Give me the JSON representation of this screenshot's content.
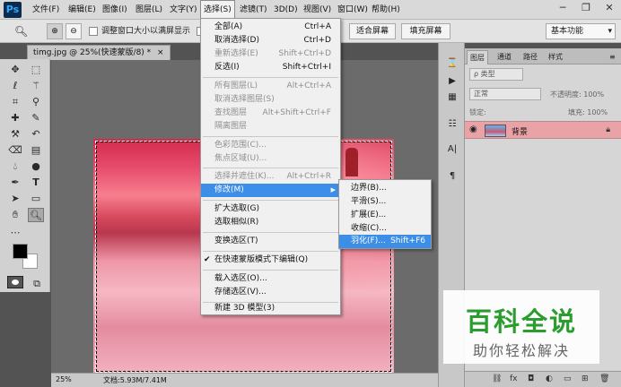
{
  "app": {
    "logo": "Ps"
  },
  "menubar": {
    "items": [
      "文件(F)",
      "编辑(E)",
      "图像(I)",
      "图层(L)",
      "文字(Y)",
      "选择(S)",
      "滤镜(T)",
      "3D(D)",
      "视图(V)",
      "窗口(W)",
      "帮助(H)"
    ],
    "active_index": 5
  },
  "options_bar": {
    "resize_windows_label": "调整窗口大小以满屏显示",
    "fit_screen_label": "适合屏幕",
    "fill_screen_label": "填充屏幕",
    "workspace": "基本功能"
  },
  "document": {
    "tab_title": "timg.jpg @ 25%(快速蒙版/8) *",
    "tab_close": "×",
    "zoom": "25%",
    "doc_size": "文档:5.93M/7.41M"
  },
  "select_menu": {
    "items": [
      {
        "label": "全部(A)",
        "shortcut": "Ctrl+A",
        "disabled": false
      },
      {
        "label": "取消选择(D)",
        "shortcut": "Ctrl+D",
        "disabled": false
      },
      {
        "label": "重新选择(E)",
        "shortcut": "Shift+Ctrl+D",
        "disabled": true
      },
      {
        "label": "反选(I)",
        "shortcut": "Shift+Ctrl+I",
        "disabled": false
      },
      {
        "label": "所有图层(L)",
        "shortcut": "Alt+Ctrl+A",
        "disabled": true
      },
      {
        "label": "取消选择图层(S)",
        "shortcut": "",
        "disabled": true
      },
      {
        "label": "查找图层",
        "shortcut": "Alt+Shift+Ctrl+F",
        "disabled": true
      },
      {
        "label": "隔离图层",
        "shortcut": "",
        "disabled": true
      },
      {
        "label": "色彩范围(C)...",
        "shortcut": "",
        "disabled": true
      },
      {
        "label": "焦点区域(U)...",
        "shortcut": "",
        "disabled": true
      },
      {
        "label": "选择并遮住(K)...",
        "shortcut": "Alt+Ctrl+R",
        "disabled": true
      },
      {
        "label": "修改(M)",
        "shortcut": "",
        "disabled": false
      },
      {
        "label": "扩大选取(G)",
        "shortcut": "",
        "disabled": false
      },
      {
        "label": "选取相似(R)",
        "shortcut": "",
        "disabled": false
      },
      {
        "label": "变换选区(T)",
        "shortcut": "",
        "disabled": false
      },
      {
        "label": "在快速蒙版模式下编辑(Q)",
        "shortcut": "",
        "disabled": false
      },
      {
        "label": "载入选区(O)...",
        "shortcut": "",
        "disabled": false
      },
      {
        "label": "存储选区(V)...",
        "shortcut": "",
        "disabled": false
      },
      {
        "label": "新建 3D 模型(3)",
        "shortcut": "",
        "disabled": false
      }
    ]
  },
  "modify_submenu": {
    "items": [
      {
        "label": "边界(B)...",
        "shortcut": ""
      },
      {
        "label": "平滑(S)...",
        "shortcut": ""
      },
      {
        "label": "扩展(E)...",
        "shortcut": ""
      },
      {
        "label": "收缩(C)...",
        "shortcut": ""
      },
      {
        "label": "羽化(F)...",
        "shortcut": "Shift+F6"
      }
    ]
  },
  "layers_panel": {
    "tabs": [
      "图层",
      "通道",
      "路径",
      "样式"
    ],
    "kind_filter": "ρ 类型",
    "blend_mode": "正常",
    "opacity_label": "不透明度: 100%",
    "lock_label": "锁定:",
    "fill_label": "填充: 100%",
    "layer_name": "背景"
  },
  "watermark": {
    "title": "百科全说",
    "subtitle": "助你轻松解决"
  }
}
